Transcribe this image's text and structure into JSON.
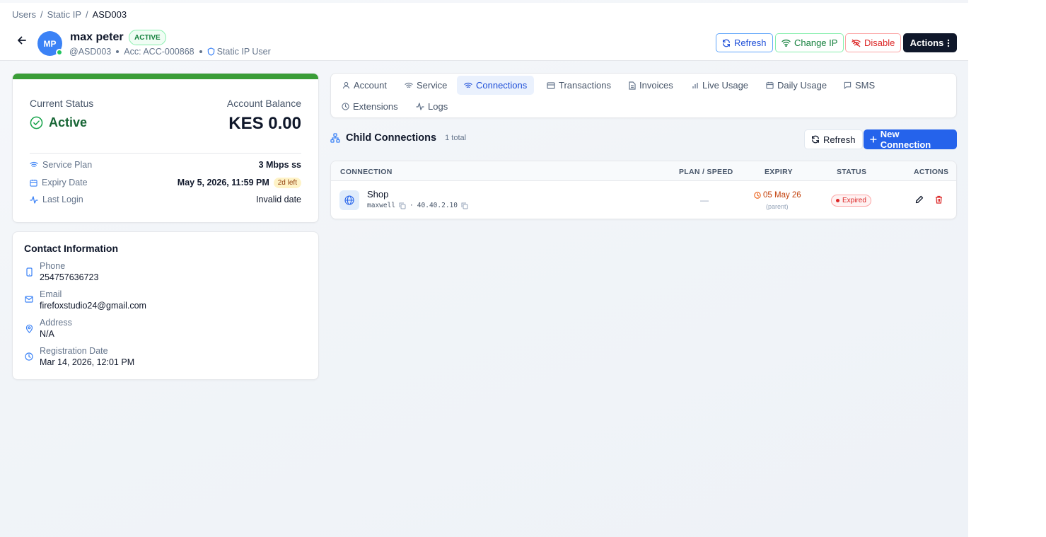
{
  "breadcrumb": {
    "items": [
      "Users",
      "Static IP"
    ],
    "current": "ASD003",
    "separator": "/"
  },
  "user": {
    "initials": "MP",
    "name": "max peter",
    "status_badge": "ACTIVE",
    "handle": "@ASD003",
    "account": "Acc: ACC-000868",
    "type": "Static IP User"
  },
  "header_buttons": {
    "refresh": "Refresh",
    "change_ip": "Change IP",
    "disable": "Disable",
    "actions": "Actions"
  },
  "status_card": {
    "status_label": "Current Status",
    "status_value": "Active",
    "balance_label": "Account Balance",
    "balance_value": "KES 0.00",
    "rows": [
      {
        "label": "Service Plan",
        "value": "3 Mbps ss"
      },
      {
        "label": "Expiry Date",
        "value": "May 5, 2026, 11:59 PM",
        "badge": "2d left"
      },
      {
        "label": "Last Login",
        "value": "Invalid date"
      }
    ]
  },
  "contact": {
    "title": "Contact Information",
    "items": [
      {
        "label": "Phone",
        "value": "254757636723",
        "icon": "phone-icon"
      },
      {
        "label": "Email",
        "value": "firefoxstudio24@gmail.com",
        "icon": "mail-icon"
      },
      {
        "label": "Address",
        "value": "N/A",
        "icon": "map-pin-icon"
      },
      {
        "label": "Registration Date",
        "value": "Mar 14, 2026, 12:01 PM",
        "icon": "clock-icon"
      }
    ]
  },
  "tabs": [
    {
      "label": "Account",
      "icon": "user-icon"
    },
    {
      "label": "Service",
      "icon": "wifi-icon"
    },
    {
      "label": "Connections",
      "icon": "wifi-icon",
      "active": true
    },
    {
      "label": "Transactions",
      "icon": "card-icon"
    },
    {
      "label": "Invoices",
      "icon": "file-icon"
    },
    {
      "label": "Live Usage",
      "icon": "bars-icon"
    },
    {
      "label": "Daily Usage",
      "icon": "calendar-icon"
    },
    {
      "label": "SMS",
      "icon": "message-icon"
    },
    {
      "label": "Extensions",
      "icon": "clock-icon"
    },
    {
      "label": "Logs",
      "icon": "activity-icon"
    }
  ],
  "connections": {
    "title": "Child Connections",
    "count": "1 total",
    "refresh": "Refresh",
    "new": "New Connection",
    "columns": [
      "CONNECTION",
      "PLAN / SPEED",
      "EXPIRY",
      "STATUS",
      "ACTIONS"
    ],
    "rows": [
      {
        "name": "Shop",
        "username": "maxwell",
        "ip": "40.40.2.10",
        "plan": "—",
        "expiry": "05 May 26",
        "expiry_note": "(parent)",
        "status": "Expired"
      }
    ]
  },
  "colors": {
    "primary": "#2563eb",
    "success": "#15803d",
    "danger": "#dc2626",
    "warning": "#c2410c",
    "status_bar": "#3a9d37"
  }
}
